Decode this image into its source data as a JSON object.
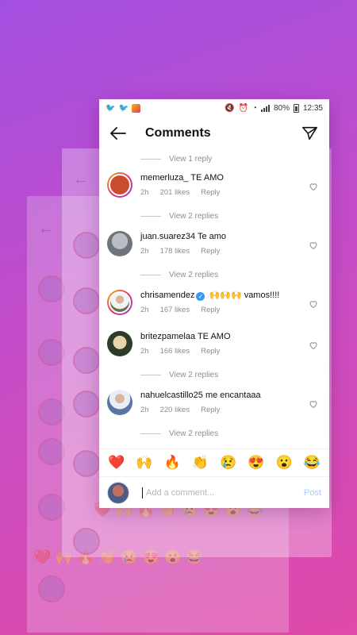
{
  "status_bar": {
    "battery": "80%",
    "time": "12:35"
  },
  "header": {
    "title": "Comments"
  },
  "replies": {
    "r0": "View 1 reply",
    "r1": "View 2 replies",
    "r2": "View 2 replies",
    "r3": "View 2 replies",
    "r4": "View 2 replies"
  },
  "comments": [
    {
      "user": "memerluza_",
      "text": "TE AMO",
      "time": "2h",
      "likes": "201 likes",
      "reply": "Reply",
      "avatar_color": "#c94d2c"
    },
    {
      "user": "juan.suarez34",
      "text": "Te amo",
      "time": "2h",
      "likes": "178 likes",
      "reply": "Reply",
      "avatar_color": "#8a8f96"
    },
    {
      "user": "chrisamendez",
      "text": "🙌🙌🙌 vamos!!!!",
      "time": "2h",
      "likes": "167 likes",
      "reply": "Reply",
      "avatar_color": "#6c6f5a"
    },
    {
      "user": "britezpamelaa",
      "text": "TE AMO",
      "time": "2h",
      "likes": "166 likes",
      "reply": "Reply",
      "avatar_color": "#c9a76e"
    },
    {
      "user": "nahuelcastillo25",
      "text": "me encantaaa",
      "time": "2h",
      "likes": "220 likes",
      "reply": "Reply",
      "avatar_color": "#5876a4"
    }
  ],
  "emojis": [
    "❤️",
    "🙌",
    "🔥",
    "👏",
    "😢",
    "😍",
    "😮",
    "😂"
  ],
  "composer": {
    "placeholder": "Add a comment...",
    "post_label": "Post"
  },
  "colors": {
    "accent": "#3897f0",
    "post_disabled": "#a8cff7",
    "bg_gradient_start": "#a24fe0",
    "bg_gradient_end": "#e04aa8"
  }
}
